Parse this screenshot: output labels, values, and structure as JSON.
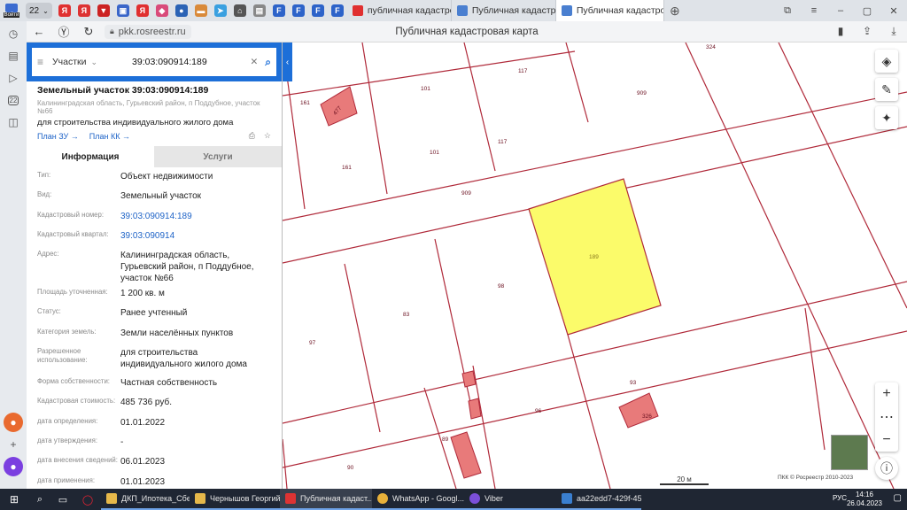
{
  "browser": {
    "login_badge": "Войти",
    "tab_count": "22",
    "tabs": [
      {
        "title": "публичная кадастровая"
      },
      {
        "title": "Публичная кадастровая"
      },
      {
        "title": "Публичная кадастровая карта"
      }
    ],
    "url": "pkk.rosreestr.ru",
    "page_title": "Публичная кадастровая карта",
    "favicon_letters": [
      "Я",
      "Я",
      "Я",
      "F",
      "F",
      "F",
      "F"
    ]
  },
  "sidebar_badge": "22",
  "search": {
    "type": "Участки",
    "value": "39:03:090914:189"
  },
  "parcel": {
    "title": "Земельный участок 39:03:090914:189",
    "address": "Калининградская область, Гурьевский район, п Поддубное, участок №66",
    "use": "для строительства индивидуального жилого дома",
    "link_plan_zu": "План ЗУ →",
    "link_plan_kk": "План КК →"
  },
  "panel_tabs": {
    "info": "Информация",
    "services": "Услуги"
  },
  "info_rows": [
    {
      "label": "Тип:",
      "value": "Объект недвижимости"
    },
    {
      "label": "Вид:",
      "value": "Земельный участок"
    },
    {
      "label": "Кадастровый номер:",
      "value": "39:03:090914:189"
    },
    {
      "label": "Кадастровый квартал:",
      "value": "39:03:090914"
    },
    {
      "label": "Адрес:",
      "value": "Калининградская область, Гурьевский район, п Поддубное, участок №66"
    },
    {
      "label": "Площадь уточненная:",
      "value": "1 200 кв. м"
    },
    {
      "label": "Статус:",
      "value": "Ранее учтенный"
    },
    {
      "label": "Категория земель:",
      "value": "Земли населённых пунктов"
    },
    {
      "label": "Разрешенное использование:",
      "value": "для строительства индивидуального жилого дома"
    },
    {
      "label": "Форма собственности:",
      "value": "Частная собственность"
    },
    {
      "label": "Кадастровая стоимость:",
      "value": "485 736 руб."
    },
    {
      "label": "дата определения:",
      "value": "01.01.2022"
    },
    {
      "label": "дата утверждения:",
      "value": "-"
    },
    {
      "label": "дата внесения сведений:",
      "value": "06.01.2023"
    },
    {
      "label": "дата применения:",
      "value": "01.01.2023"
    }
  ],
  "map_labels": [
    "324",
    "117",
    "909",
    "161",
    "101",
    "101",
    "161",
    "117",
    "909",
    "189",
    "98",
    "83",
    "97",
    "93",
    "96",
    "89",
    "90",
    "326"
  ],
  "map_building_labels": [
    "477",
    "326"
  ],
  "scale_label": "20 м",
  "copyright": "ПКК © Росреестр 2010-2023",
  "taskbar": {
    "apps": [
      "ДКП_Ипотека_Сбе...",
      "Чернышов Георгий",
      "Публичная кадаст...",
      "WhatsApp - Googl...",
      "Viber",
      "aa22edd7-429f-450..."
    ],
    "lang": "РУС",
    "time": "14:16",
    "date": "26.04.2023"
  },
  "colors": {
    "accent": "#1d6fd8",
    "highlight_parcel": "#fbfb6a",
    "parcel_line": "#b02a3a",
    "building": "#e87a7a"
  }
}
